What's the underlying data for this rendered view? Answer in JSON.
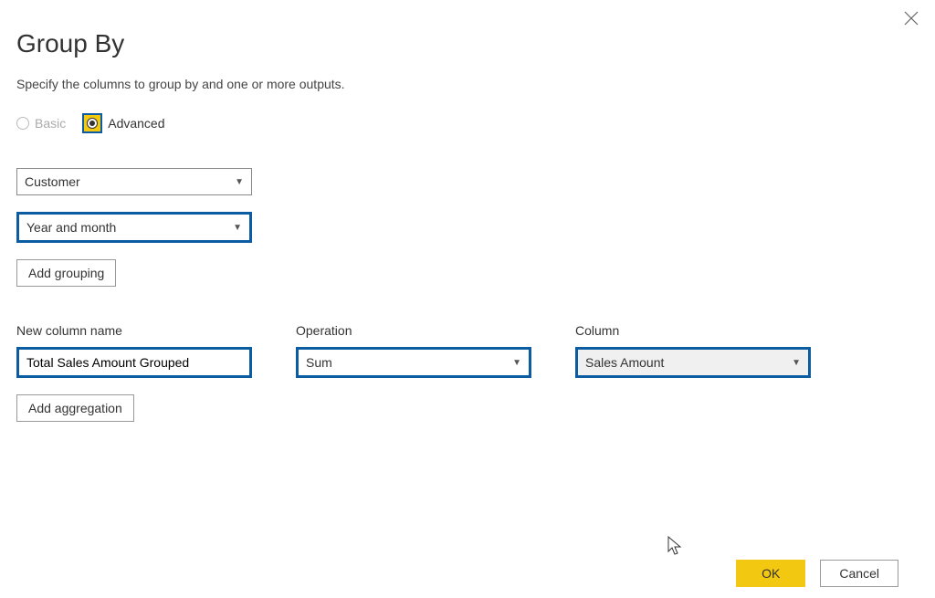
{
  "dialog": {
    "title": "Group By",
    "subtitle": "Specify the columns to group by and one or more outputs."
  },
  "mode": {
    "basic_label": "Basic",
    "advanced_label": "Advanced"
  },
  "grouping": {
    "combos": [
      {
        "value": "Customer",
        "highlighted": false
      },
      {
        "value": "Year and month",
        "highlighted": true
      }
    ],
    "add_label": "Add grouping"
  },
  "aggregation": {
    "headers": {
      "name": "New column name",
      "operation": "Operation",
      "column": "Column"
    },
    "row": {
      "name_value": "Total Sales Amount Grouped",
      "operation_value": "Sum",
      "column_value": "Sales Amount"
    },
    "add_label": "Add aggregation"
  },
  "footer": {
    "ok": "OK",
    "cancel": "Cancel"
  }
}
